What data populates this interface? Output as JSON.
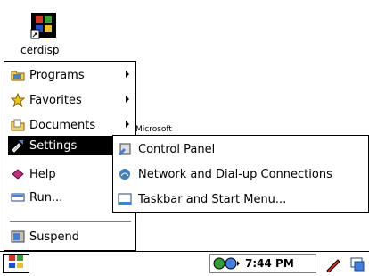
{
  "desktop": {
    "icon_label": "cerdisp",
    "microsoft_text": "Microsoft"
  },
  "start_menu": {
    "items": [
      {
        "label": "Programs",
        "has_submenu": true,
        "icon": "folder-programs-icon"
      },
      {
        "label": "Favorites",
        "has_submenu": true,
        "icon": "star-icon"
      },
      {
        "label": "Documents",
        "has_submenu": true,
        "icon": "folder-documents-icon"
      },
      {
        "label": "Settings",
        "has_submenu": true,
        "selected": true,
        "icon": "settings-icon"
      },
      {
        "label": "Help",
        "has_submenu": false,
        "icon": "help-book-icon"
      },
      {
        "label": "Run...",
        "has_submenu": false,
        "icon": "run-icon"
      },
      {
        "label": "Suspend",
        "has_submenu": false,
        "icon": "suspend-icon"
      }
    ]
  },
  "settings_submenu": {
    "items": [
      {
        "label": "Control Panel",
        "icon": "control-panel-icon"
      },
      {
        "label": "Network and Dial-up Connections",
        "icon": "network-icon"
      },
      {
        "label": "Taskbar and Start Menu...",
        "icon": "taskbar-icon"
      }
    ]
  },
  "taskbar": {
    "clock": "7:44 PM"
  },
  "colors": {
    "selection": "#000000",
    "background": "#ffffff"
  }
}
